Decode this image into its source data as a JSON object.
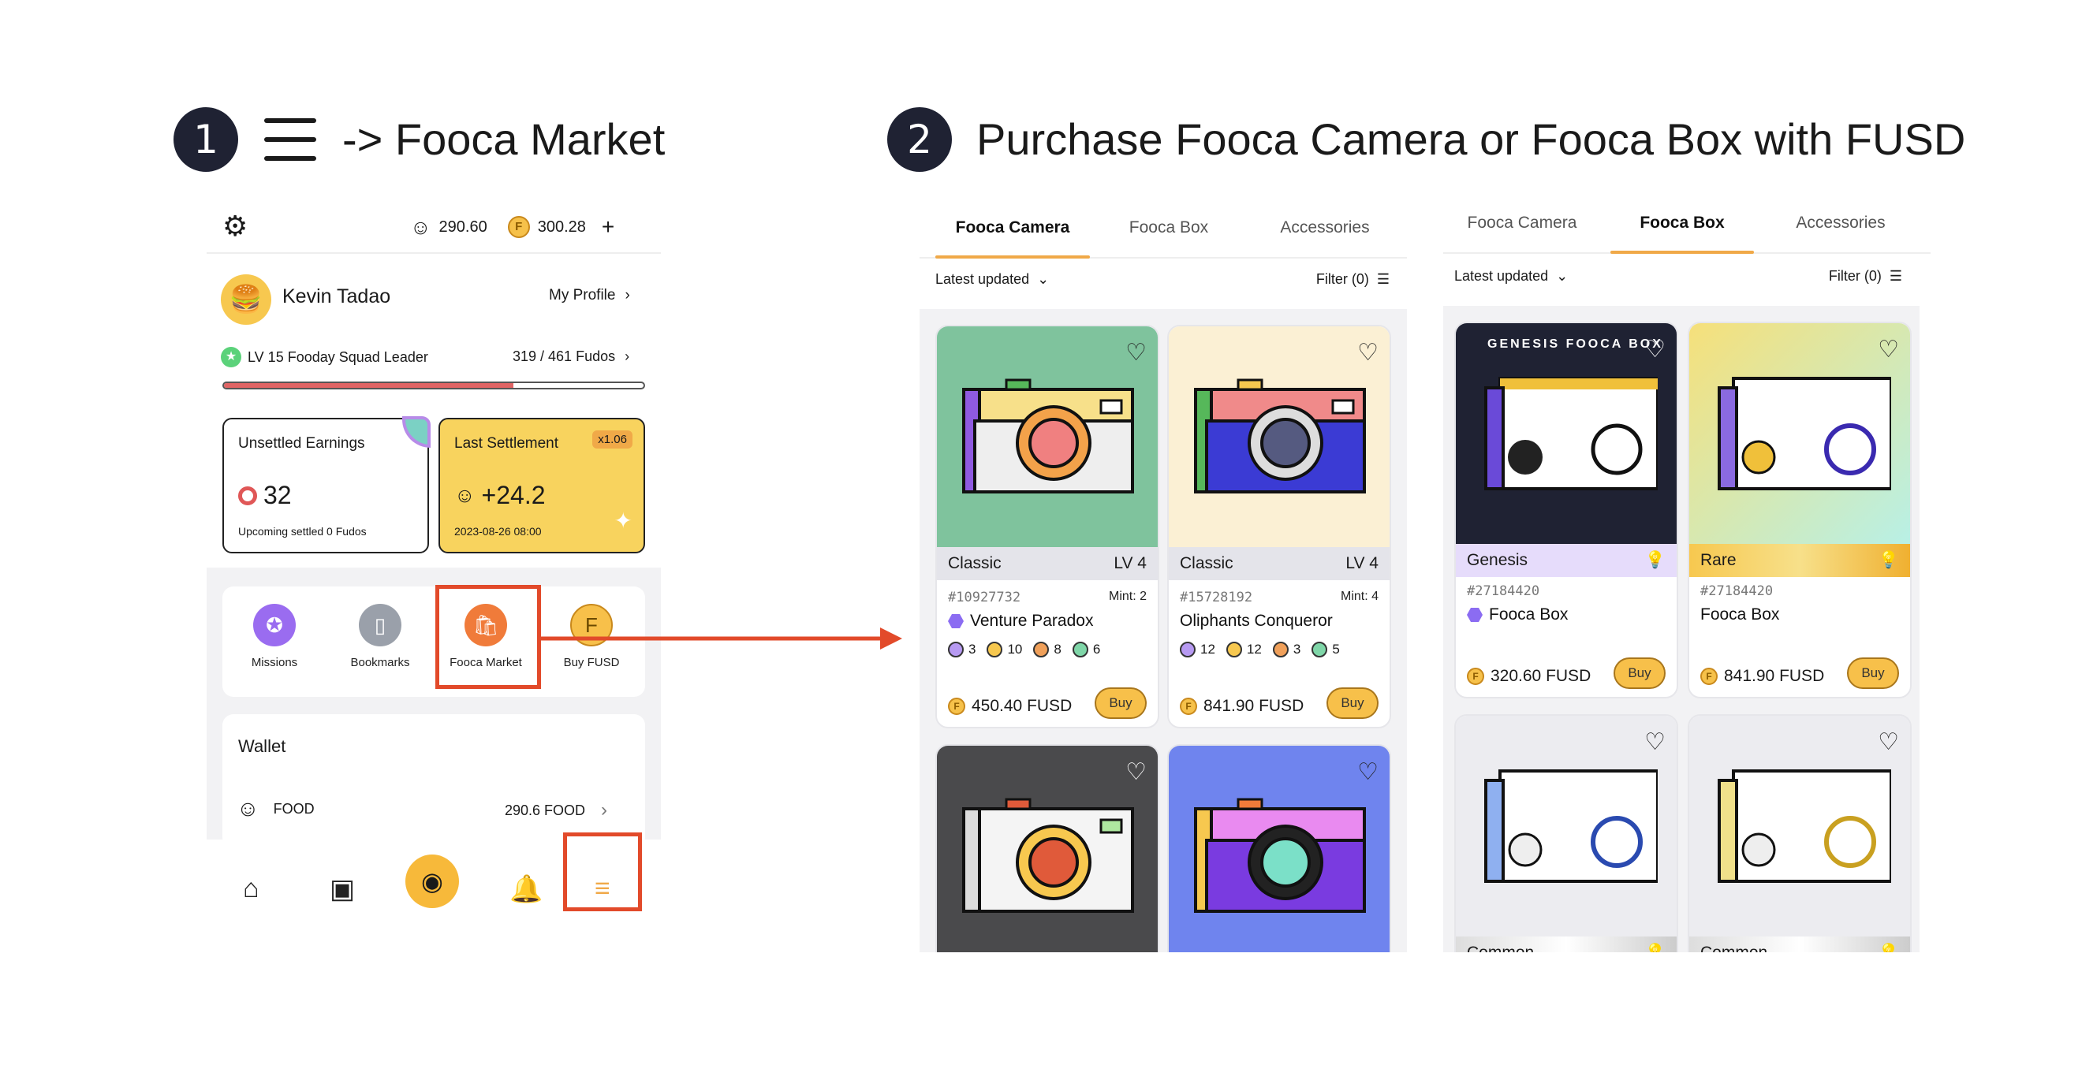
{
  "step1": {
    "number": "1",
    "title": "-> Fooca Market"
  },
  "step2": {
    "number": "2",
    "title": "Purchase Fooca Camera or Fooca Box with FUSD"
  },
  "app": {
    "food_balance": "290.60",
    "fusd_balance": "300.28",
    "user_name": "Kevin Tadao",
    "my_profile": "My Profile",
    "level_text": "LV 15 Fooday Squad Leader",
    "fudos_progress": "319 / 461 Fudos",
    "progress_fraction": 0.69,
    "unsettled_title": "Unsettled Earnings",
    "unsettled_value": "32",
    "unsettled_sub": "Upcoming settled 0 Fudos",
    "settlement_title": "Last Settlement",
    "settlement_multiplier": "x1.06",
    "settlement_value": "+24.2",
    "settlement_date": "2023-08-26 08:00",
    "quick_actions": [
      "Missions",
      "Bookmarks",
      "Fooca Market",
      "Buy FUSD"
    ],
    "wallet_title": "Wallet",
    "wallet_token": "FOOD",
    "wallet_amount": "290.6 FOOD"
  },
  "market_camera": {
    "tabs": [
      "Fooca Camera",
      "Fooca Box",
      "Accessories"
    ],
    "sort": "Latest updated",
    "filter": "Filter (0)",
    "cards": [
      {
        "rarity": "Classic",
        "level": "LV 4",
        "id": "#10927732",
        "mint": "Mint: 2",
        "name": "Venture Paradox",
        "attrs": [
          "3",
          "10",
          "8",
          "6"
        ],
        "price": "450.40 FUSD",
        "buy": "Buy",
        "bg": "#7fc39d"
      },
      {
        "rarity": "Classic",
        "level": "LV 4",
        "id": "#15728192",
        "mint": "Mint: 4",
        "name": "Oliphants Conqueror",
        "attrs": [
          "12",
          "12",
          "3",
          "5"
        ],
        "price": "841.90 FUSD",
        "buy": "Buy",
        "bg": "#fbf0d4"
      },
      {
        "bg": "#4a4a4c"
      },
      {
        "bg": "#6f84ee"
      }
    ]
  },
  "market_box": {
    "tabs": [
      "Fooca Camera",
      "Fooca Box",
      "Accessories"
    ],
    "sort": "Latest updated",
    "filter": "Filter (0)",
    "cards": [
      {
        "banner": "GENESIS FOOCA BOX",
        "rarity": "Genesis",
        "id": "#27184420",
        "name": "Fooca Box",
        "price": "320.60 FUSD",
        "buy": "Buy"
      },
      {
        "rarity": "Rare",
        "id": "#27184420",
        "name": "Fooca Box",
        "price": "841.90 FUSD",
        "buy": "Buy"
      },
      {
        "rarity": "Common"
      },
      {
        "rarity": "Common"
      }
    ]
  },
  "colors": {
    "accent": "#f0a948",
    "highlight": "#e24a2a",
    "navy": "#1f2233"
  }
}
